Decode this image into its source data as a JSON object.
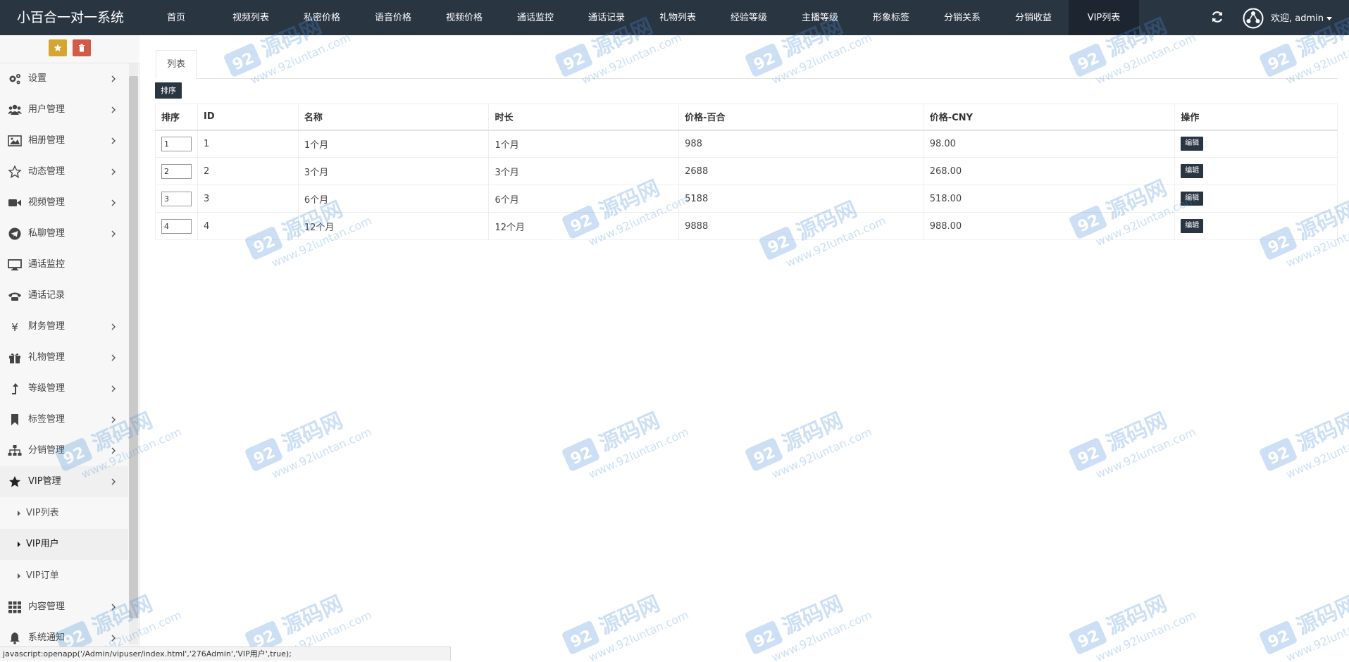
{
  "app": {
    "title": "小百合一对一系统"
  },
  "topnav": {
    "items": [
      {
        "label": "首页"
      },
      {
        "label": "视频列表"
      },
      {
        "label": "私密价格"
      },
      {
        "label": "语音价格"
      },
      {
        "label": "视频价格"
      },
      {
        "label": "通话监控"
      },
      {
        "label": "通话记录"
      },
      {
        "label": "礼物列表"
      },
      {
        "label": "经验等级"
      },
      {
        "label": "主播等级"
      },
      {
        "label": "形象标签"
      },
      {
        "label": "分销关系"
      },
      {
        "label": "分销收益"
      },
      {
        "label": "VIP列表"
      }
    ],
    "active": "VIP列表",
    "user_greeting": "欢迎, admin"
  },
  "sidebar": {
    "items": [
      {
        "label": "设置",
        "icon": "gears-icon",
        "has_children": true
      },
      {
        "label": "用户管理",
        "icon": "users-icon",
        "has_children": true
      },
      {
        "label": "相册管理",
        "icon": "picture-icon",
        "has_children": true
      },
      {
        "label": "动态管理",
        "icon": "star-outline-icon",
        "has_children": true
      },
      {
        "label": "视频管理",
        "icon": "video-camera-icon",
        "has_children": true
      },
      {
        "label": "私聊管理",
        "icon": "telegram-icon",
        "has_children": true
      },
      {
        "label": "通话监控",
        "icon": "monitor-icon",
        "has_children": false
      },
      {
        "label": "通话记录",
        "icon": "phone-icon",
        "has_children": false
      },
      {
        "label": "财务管理",
        "icon": "yen-icon",
        "has_children": true
      },
      {
        "label": "礼物管理",
        "icon": "gift-icon",
        "has_children": true
      },
      {
        "label": "等级管理",
        "icon": "level-up-icon",
        "has_children": true
      },
      {
        "label": "标签管理",
        "icon": "bookmark-icon",
        "has_children": true
      },
      {
        "label": "分销管理",
        "icon": "sitemap-icon",
        "has_children": true
      },
      {
        "label": "VIP管理",
        "icon": "star-icon",
        "has_children": true
      },
      {
        "label": "内容管理",
        "icon": "grid-icon",
        "has_children": true
      },
      {
        "label": "系统通知",
        "icon": "bell-icon",
        "has_children": true
      }
    ],
    "vip_submenu": [
      {
        "label": "VIP列表"
      },
      {
        "label": "VIP用户"
      },
      {
        "label": "VIP订单"
      }
    ],
    "active_submenu": "VIP用户"
  },
  "content": {
    "tab_label": "列表",
    "sort_button_label": "排序",
    "table": {
      "headers": [
        "排序",
        "ID",
        "名称",
        "时长",
        "价格-百合",
        "价格-CNY",
        "操作"
      ],
      "rows": [
        {
          "sort": "1",
          "id": "1",
          "name": "1个月",
          "duration": "1个月",
          "price_lily": "988",
          "price_cny": "98.00",
          "action": "编辑"
        },
        {
          "sort": "2",
          "id": "2",
          "name": "3个月",
          "duration": "3个月",
          "price_lily": "2688",
          "price_cny": "268.00",
          "action": "编辑"
        },
        {
          "sort": "3",
          "id": "3",
          "name": "6个月",
          "duration": "6个月",
          "price_lily": "5188",
          "price_cny": "518.00",
          "action": "编辑"
        },
        {
          "sort": "4",
          "id": "4",
          "name": "12个月",
          "duration": "12个月",
          "price_lily": "9888",
          "price_cny": "988.00",
          "action": "编辑"
        }
      ]
    }
  },
  "statusbar": {
    "text": "javascript:openapp('/Admin/vipuser/index.html','276Admin','VIP用户',true);"
  },
  "watermark": {
    "line1": "源码网",
    "line2": "www.92luntan.com",
    "logo": "92"
  },
  "colors": {
    "navbar": "#2a3542",
    "navbar_active": "#1c2530",
    "shortcut_yellow": "#d6a431",
    "shortcut_red": "#d15b47",
    "watermark": "#4a90d9"
  }
}
